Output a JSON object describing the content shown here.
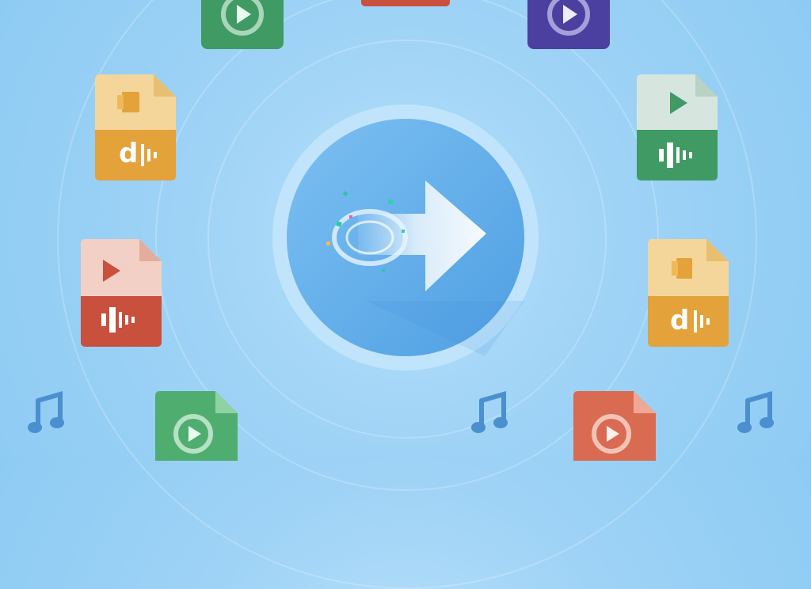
{
  "scene": {
    "type": "audio-video-conversion-illustration",
    "colors": {
      "background": "#9fd3f6",
      "ring": "#ffffff",
      "circle_inner": "#6fb6ee",
      "circle_outer": "#c8e8fd",
      "green": "#3f9a63",
      "purple": "#4b3fa0",
      "red": "#c8503c",
      "orange": "#e3a23a",
      "note": "#4b8fd0"
    },
    "icons": [
      "music-note-icon",
      "play-icon",
      "audio-wave-icon",
      "convert-arrow-icon"
    ]
  }
}
